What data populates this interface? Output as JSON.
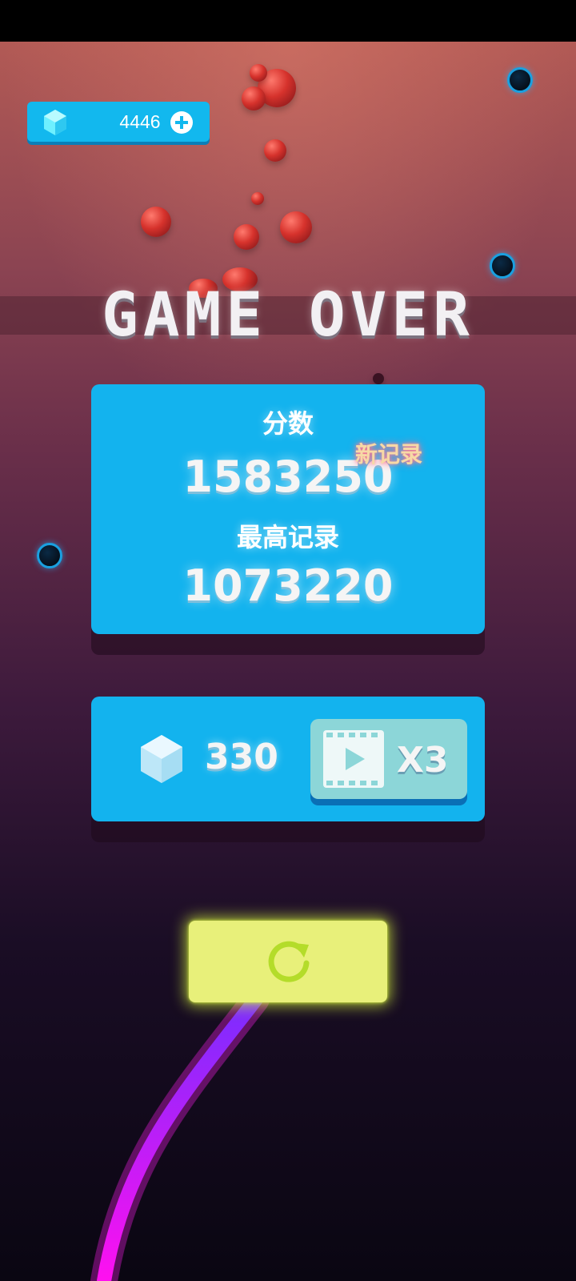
{
  "currency": {
    "gems": "4446",
    "icon": "gem-icon",
    "add_icon": "plus-icon"
  },
  "title": "GAME OVER",
  "score_panel": {
    "score_label": "分数",
    "score_value": "1583250",
    "new_record_badge": "新记录",
    "best_label": "最高记录",
    "best_value": "1073220"
  },
  "reward_panel": {
    "gem_reward": "330",
    "video_multiplier": "X3",
    "video_icon": "video-play-icon"
  },
  "restart": {
    "icon": "restart-icon"
  },
  "colors": {
    "panel": "#13b3ee",
    "restart_button": "#e8f07a",
    "trail_start": "#7a2cff",
    "trail_end": "#ff10f0"
  }
}
